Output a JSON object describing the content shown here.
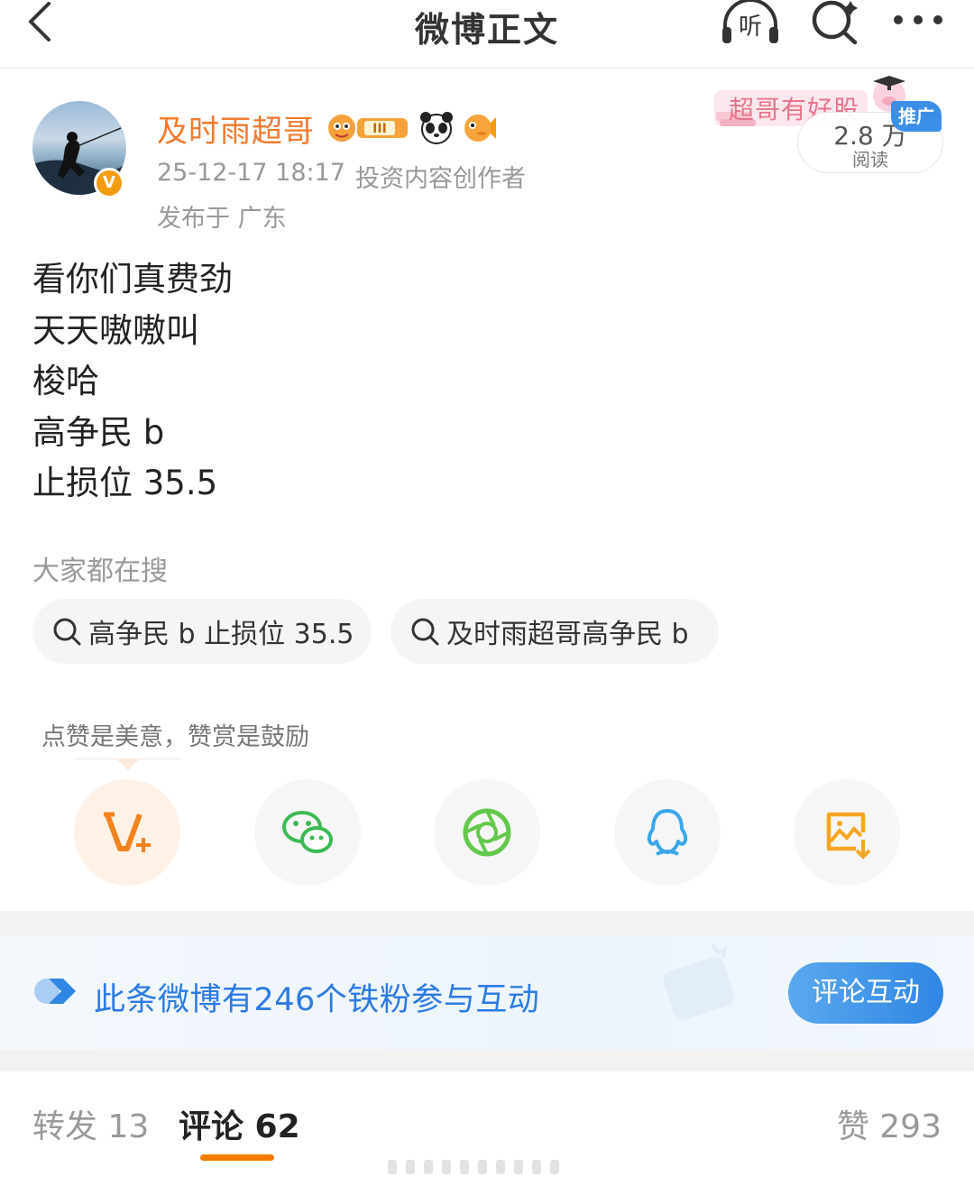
{
  "nav": {
    "title": "微博正文",
    "listen_label": "听"
  },
  "author": {
    "name": "及时雨超哥",
    "verified_badge": "V",
    "level_badge": "III",
    "time": "25-12-17 18:17",
    "role": "投资内容创作者",
    "location": "发布于 广东"
  },
  "promo": {
    "tag_text": "超哥有好股",
    "ad_label": "推广",
    "reads_count": "2.8 万",
    "reads_label": "阅读"
  },
  "post": {
    "lines": [
      "看你们真费劲",
      "天天嗷嗷叫",
      "梭哈",
      "高争民 b",
      "止损位 35.5"
    ]
  },
  "hot_search": {
    "label": "大家都在搜",
    "chips": [
      "高争民 b 止损位 35.5",
      "及时雨超哥高争民 b"
    ]
  },
  "share": {
    "tip": "点赞是美意，赞赏是鼓励",
    "icons": [
      "vip-reward-icon",
      "wechat-icon",
      "moments-icon",
      "qq-icon",
      "save-image-icon"
    ]
  },
  "fan_banner": {
    "text": "此条微博有246个铁粉参与互动",
    "button": "评论互动"
  },
  "tabs": {
    "repost": "转发 13",
    "comment": "评论 62",
    "like": "赞 293"
  },
  "colors": {
    "accent_orange": "#f47a2d",
    "link_blue": "#2c7be5",
    "tab_underline": "#f57c00",
    "ad_blue": "#3b8ee8"
  }
}
